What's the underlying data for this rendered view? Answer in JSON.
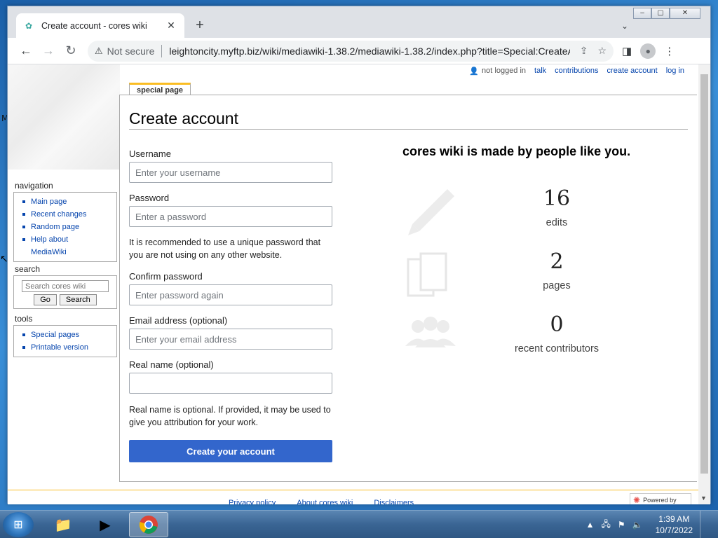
{
  "browser": {
    "tab_title": "Create account - cores wiki",
    "tab_close": "✕",
    "new_tab": "+",
    "not_secure": "Not secure",
    "url": "leightoncity.myftp.biz/wiki/mediawiki-1.38.2/mediawiki-1.38.2/index.php?title=Special:CreateA..."
  },
  "personal_tools": {
    "not_logged_in": "not logged in",
    "talk": "talk",
    "contributions": "contributions",
    "create_account": "create account",
    "log_in": "log in"
  },
  "sidebar": {
    "navigation": {
      "heading": "navigation",
      "items": [
        "Main page",
        "Recent changes",
        "Random page",
        "Help about MediaWiki"
      ]
    },
    "search": {
      "heading": "search",
      "placeholder": "Search cores wiki",
      "go_label": "Go",
      "search_label": "Search"
    },
    "tools": {
      "heading": "tools",
      "items": [
        "Special pages",
        "Printable version"
      ]
    }
  },
  "content_tab": "special page",
  "page_title": "Create account",
  "form": {
    "username_label": "Username",
    "username_placeholder": "Enter your username",
    "password_label": "Password",
    "password_placeholder": "Enter a password",
    "password_note": "It is recommended to use a unique password that you are not using on any other website.",
    "confirm_label": "Confirm password",
    "confirm_placeholder": "Enter password again",
    "email_label": "Email address (optional)",
    "email_placeholder": "Enter your email address",
    "realname_label": "Real name (optional)",
    "realname_value": "",
    "realname_note": "Real name is optional. If provided, it may be used to give you attribution for your work.",
    "submit_label": "Create your account"
  },
  "promo": {
    "title": "cores wiki is made by people like you.",
    "stats": [
      {
        "value": "16",
        "label": "edits",
        "icon": "pencil-icon"
      },
      {
        "value": "2",
        "label": "pages",
        "icon": "pages-icon"
      },
      {
        "value": "0",
        "label": "recent contributors",
        "icon": "people-icon"
      }
    ]
  },
  "footer": {
    "links": [
      "Privacy policy",
      "About cores wiki",
      "Disclaimers"
    ],
    "powered_by": "Powered by"
  },
  "taskbar": {
    "time": "1:39 AM",
    "date": "10/7/2022"
  },
  "colors": {
    "link": "#0645ad",
    "primary_button": "#3366cc",
    "tab_accent": "#fabd23"
  }
}
